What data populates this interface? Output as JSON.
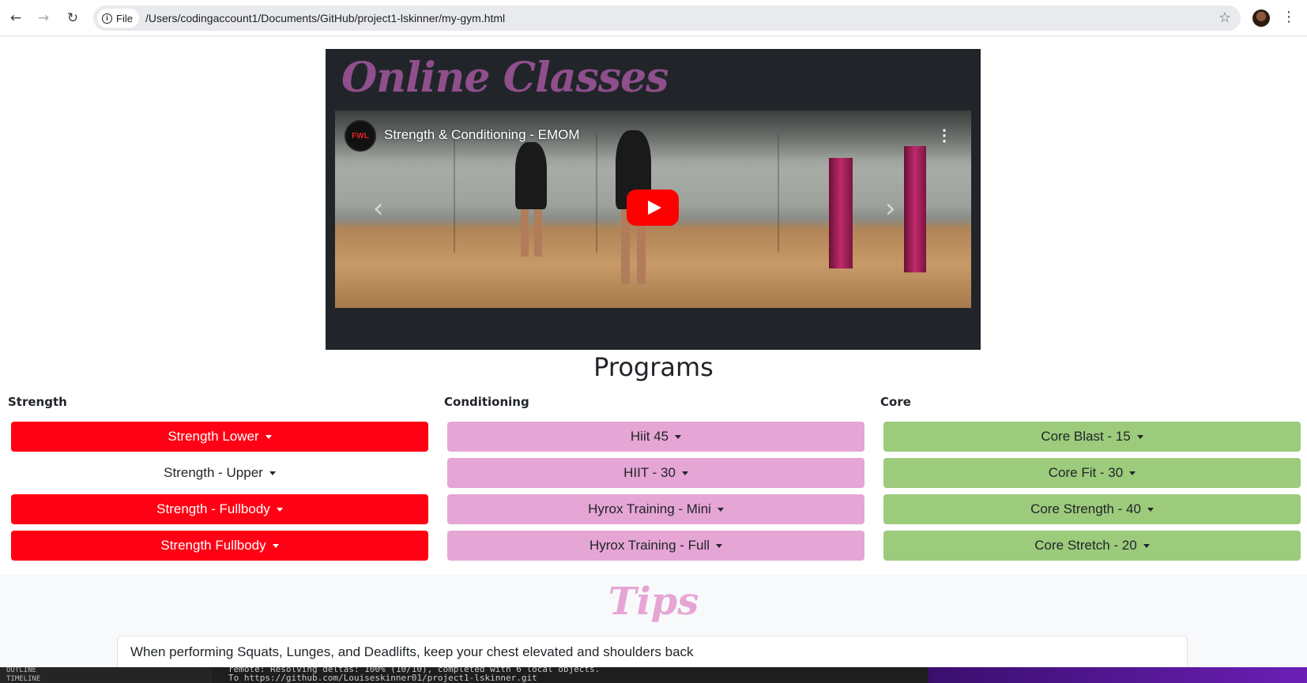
{
  "browser": {
    "chip_label": "File",
    "url": "/Users/codingaccount1/Documents/GitHub/project1-lskinner/my-gym.html"
  },
  "online_classes": {
    "title": "Online Classes",
    "video": {
      "channel_logo_text": "FWL",
      "title": "Strength & Conditioning - EMOM"
    }
  },
  "programs": {
    "heading": "Programs",
    "columns": [
      {
        "label": "Strength",
        "buttons": [
          "Strength Lower",
          "Strength - Upper",
          "Strength - Fullbody",
          "Strength Fullbody"
        ]
      },
      {
        "label": "Conditioning",
        "buttons": [
          "Hiit 45",
          "HIIT - 30",
          "Hyrox Training - Mini",
          "Hyrox Training - Full"
        ]
      },
      {
        "label": "Core",
        "buttons": [
          "Core Blast - 15",
          "Core Fit - 30",
          "Core Strength - 40",
          "Core Stretch - 20"
        ]
      }
    ]
  },
  "tips": {
    "title": "Tips",
    "items": [
      "When performing Squats, Lunges, and Deadlifts, keep your chest elevated and shoulders back"
    ]
  },
  "background_window": {
    "sidebar_labels": [
      "OUTLINE",
      "TIMELINE"
    ],
    "terminal_lines": [
      "remote: Resolving deltas: 100% (10/10), completed with 6 local objects.",
      "To https://github.com/Louiseskinner01/project1-lskinner.git"
    ]
  },
  "colors": {
    "strength": "#ff0014",
    "conditioning": "#e5a5d5",
    "core": "#9ccb7c",
    "classes_title": "#8e4f8c",
    "dark_panel": "#212529"
  }
}
